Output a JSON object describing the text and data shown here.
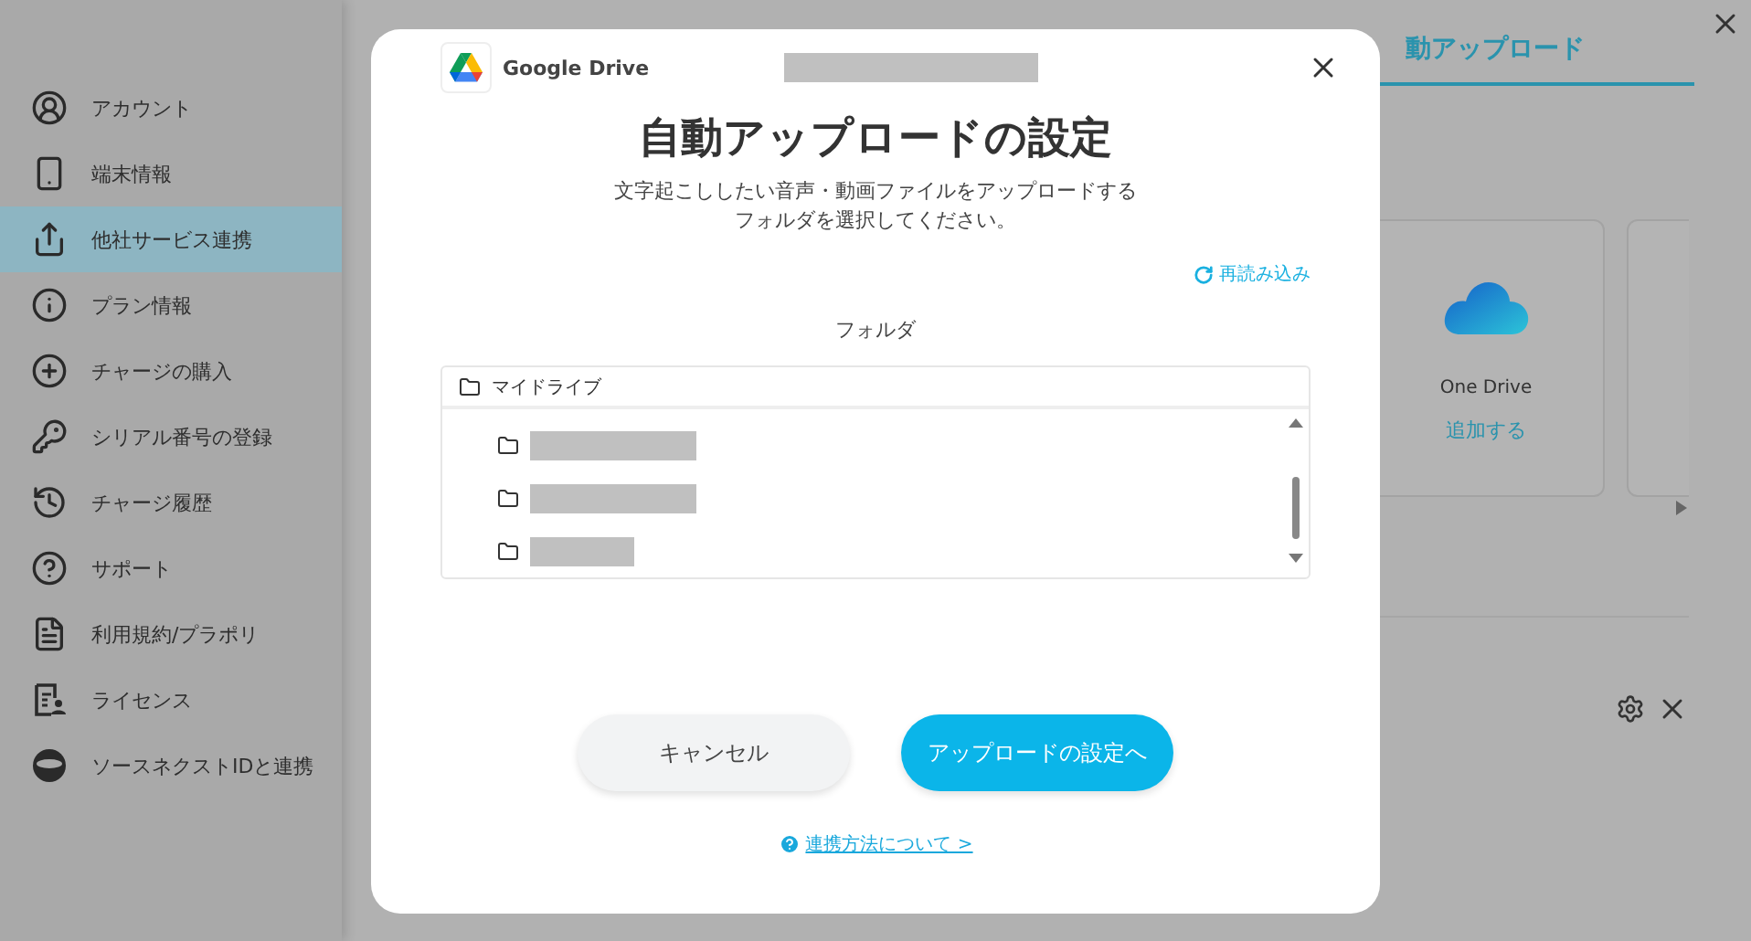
{
  "sidebar": {
    "items": [
      {
        "label": "アカウント",
        "selected": false
      },
      {
        "label": "端末情報",
        "selected": false
      },
      {
        "label": "他社サービス連携",
        "selected": true
      },
      {
        "label": "プラン情報",
        "selected": false
      },
      {
        "label": "チャージの購入",
        "selected": false
      },
      {
        "label": "シリアル番号の登録",
        "selected": false
      },
      {
        "label": "チャージ履歴",
        "selected": false
      },
      {
        "label": "サポート",
        "selected": false
      },
      {
        "label": "利用規約/プラポリ",
        "selected": false
      },
      {
        "label": "ライセンス",
        "selected": false
      },
      {
        "label": "ソースネクストIDと連携",
        "selected": false
      }
    ]
  },
  "background": {
    "tab": "動アップロード",
    "card": {
      "name": "One Drive",
      "action": "追加する"
    }
  },
  "dialog": {
    "service": "Google Drive",
    "title": "自動アップロードの設定",
    "description": [
      "文字起こししたい音声・動画ファイルをアップロードする",
      "フォルダを選択してください。"
    ],
    "reload": "再読み込み",
    "folder_label": "フォルダ",
    "root_folder": "マイドライブ",
    "folders": [
      {
        "kind": "long"
      },
      {
        "kind": "long"
      },
      {
        "kind": "short"
      }
    ],
    "buttons": [
      {
        "label": "キャンセル",
        "kind": "secondary"
      },
      {
        "label": "アップロードの設定へ",
        "kind": "primary"
      }
    ],
    "help_link": "連携方法について >"
  }
}
